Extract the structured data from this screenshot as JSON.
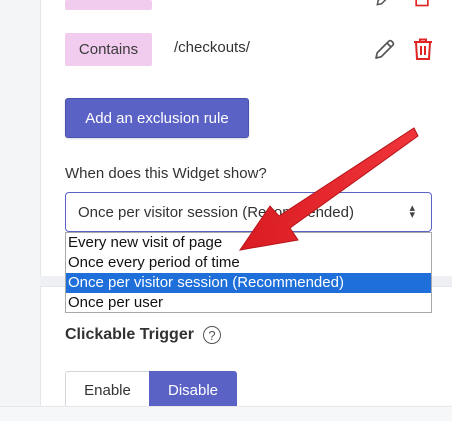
{
  "rules": [
    {
      "match_type": "",
      "value": ""
    },
    {
      "match_type": "Contains",
      "value": "/checkouts/"
    }
  ],
  "add_exclusion_label": "Add an exclusion rule",
  "widget_show": {
    "question": "When does this Widget show?",
    "selected": "Once per visitor session (Recommended)",
    "options": [
      "Every new visit of page",
      "Once every period of time",
      "Once per visitor session (Recommended)",
      "Once per user"
    ]
  },
  "clickable_trigger": {
    "title": "Clickable Trigger",
    "enable_label": "Enable",
    "disable_label": "Disable",
    "active": "Disable"
  },
  "colors": {
    "accent": "#5a62c6",
    "tag_bg": "#f2ccef",
    "delete_red": "#e02424",
    "selected_option": "#1e6fd9",
    "annotation_arrow": "#e8242a"
  },
  "icons": [
    "edit-pencil-icon",
    "trash-icon",
    "help-circle-icon",
    "select-caret-icon"
  ]
}
